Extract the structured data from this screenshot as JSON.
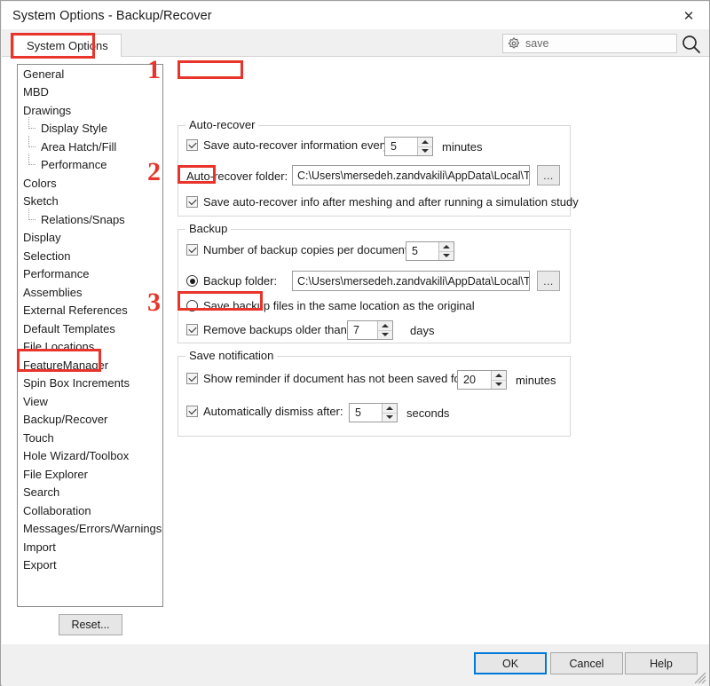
{
  "window": {
    "title": "System Options - Backup/Recover",
    "close_icon": "close-icon"
  },
  "tabs": {
    "system_options": "System Options"
  },
  "search": {
    "gear_icon": "gear-icon",
    "value": "save",
    "search_icon": "search-icon"
  },
  "tree": {
    "items": [
      {
        "label": "General",
        "level": 0
      },
      {
        "label": "MBD",
        "level": 0
      },
      {
        "label": "Drawings",
        "level": 0
      },
      {
        "label": "Display Style",
        "level": 1
      },
      {
        "label": "Area Hatch/Fill",
        "level": 1
      },
      {
        "label": "Performance",
        "level": 1
      },
      {
        "label": "Colors",
        "level": 0
      },
      {
        "label": "Sketch",
        "level": 0
      },
      {
        "label": "Relations/Snaps",
        "level": 1
      },
      {
        "label": "Display",
        "level": 0
      },
      {
        "label": "Selection",
        "level": 0
      },
      {
        "label": "Performance",
        "level": 0
      },
      {
        "label": "Assemblies",
        "level": 0
      },
      {
        "label": "External References",
        "level": 0
      },
      {
        "label": "Default Templates",
        "level": 0
      },
      {
        "label": "File Locations",
        "level": 0
      },
      {
        "label": "FeatureManager",
        "level": 0
      },
      {
        "label": "Spin Box Increments",
        "level": 0
      },
      {
        "label": "View",
        "level": 0
      },
      {
        "label": "Backup/Recover",
        "level": 0
      },
      {
        "label": "Touch",
        "level": 0
      },
      {
        "label": "Hole Wizard/Toolbox",
        "level": 0
      },
      {
        "label": "File Explorer",
        "level": 0
      },
      {
        "label": "Search",
        "level": 0
      },
      {
        "label": "Collaboration",
        "level": 0
      },
      {
        "label": "Messages/Errors/Warnings",
        "level": 0
      },
      {
        "label": "Import",
        "level": 0
      },
      {
        "label": "Export",
        "level": 0
      }
    ],
    "selected": "Backup/Recover",
    "reset_label": "Reset..."
  },
  "autorecover": {
    "legend": "Auto-recover",
    "save_every_label": "Save auto-recover information every:",
    "save_every_checked": true,
    "save_every_value": "5",
    "save_every_unit": "minutes",
    "folder_label": "Auto-recover folder:",
    "folder_value": "C:\\Users\\mersedeh.zandvakili\\AppData\\Local\\TempS",
    "browse_label": "...",
    "after_meshing_label": "Save auto-recover info after meshing and after running a simulation study",
    "after_meshing_checked": true
  },
  "backup": {
    "legend": "Backup",
    "copies_label": "Number of backup copies per document:",
    "copies_checked": true,
    "copies_value": "5",
    "folder_radio_label": "Backup folder:",
    "folder_radio_selected": true,
    "folder_value": "C:\\Users\\mersedeh.zandvakili\\AppData\\Local\\TempS",
    "browse_label": "...",
    "same_location_label": "Save backup files in the same location as the original",
    "same_location_selected": false,
    "remove_older_label": "Remove backups older than",
    "remove_older_checked": true,
    "remove_older_value": "7",
    "remove_older_unit": "days"
  },
  "savenotification": {
    "legend": "Save notification",
    "reminder_label": "Show reminder if document has not been saved for:",
    "reminder_checked": true,
    "reminder_value": "20",
    "reminder_unit": "minutes",
    "dismiss_label": "Automatically dismiss after:",
    "dismiss_checked": true,
    "dismiss_value": "5",
    "dismiss_unit": "seconds"
  },
  "footer": {
    "ok": "OK",
    "cancel": "Cancel",
    "help": "Help"
  },
  "annotations": {
    "color": "#e8342a",
    "num1": "1",
    "num2": "2",
    "num3": "3"
  }
}
